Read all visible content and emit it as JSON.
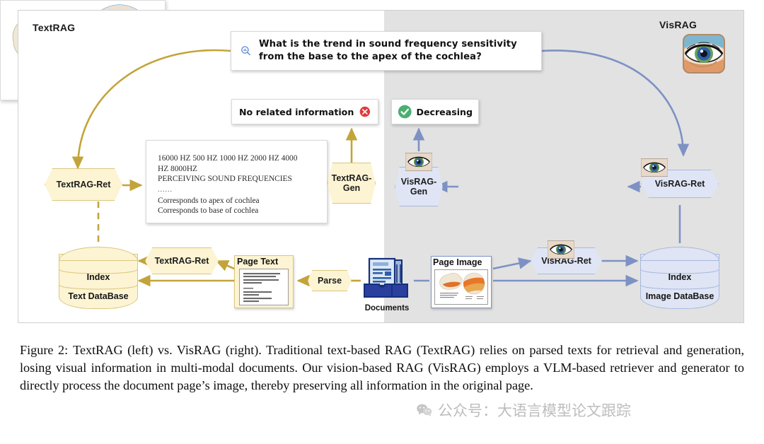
{
  "figure": {
    "left_panel_title": "TextRAG",
    "right_panel_title": "VisRAG",
    "query": {
      "icon": "search-chart-icon",
      "text": "What is the trend in sound frequency sensitivity from the base to the apex of the cochlea?"
    },
    "answers": {
      "text_rag": {
        "label": "No related information",
        "status_icon": "error-cross-icon",
        "status_color": "#e03a3a"
      },
      "vis_rag": {
        "label": "Decreasing",
        "status_icon": "success-check-icon",
        "status_color": "#4caf72"
      }
    },
    "parsed_text": {
      "line1": "16000 HZ 500 HZ 1000 HZ 2000 HZ 4000",
      "line2": "HZ 8000HZ",
      "line3": "PERCEIVING SOUND FREQUENCIES",
      "ellipsis": "......",
      "line4": "Corresponds to apex of cochlea",
      "line5": "Corresponds to base of cochlea"
    },
    "nodes": {
      "textrag_ret_top": "TextRAG-Ret",
      "textrag_ret_bottom": "TextRAG-Ret",
      "textrag_gen": "TextRAG-\nGen",
      "textrag_gen_l1": "TextRAG-",
      "textrag_gen_l2": "Gen",
      "visrag_gen_l1": "VisRAG-",
      "visrag_gen_l2": "Gen",
      "visrag_ret_right": "VisRAG-Ret",
      "visrag_ret_bottom": "VisRAG-Ret",
      "parse": "Parse"
    },
    "databases": {
      "left": {
        "index": "Index",
        "name": "Text DataBase"
      },
      "right": {
        "index": "Index",
        "name": "Image DataBase"
      }
    },
    "artifacts": {
      "page_text": "Page Text",
      "page_image": "Page Image",
      "documents": "Documents"
    },
    "page_document": {
      "heading": "PERCEIVING SOUND FREQUENCIES",
      "body_line1": "In the primary auditory cortex, neurons are sited",
      "body_line2": "according to the frequency each responds to, as",
      "body_line3": "are the sensory cells in the cochlea.",
      "callout_left_l1": "Corresponds",
      "callout_left_l2": "to apex of",
      "callout_left_l3": "cochlea",
      "callout_right_l1": "Corresponds",
      "callout_right_l2": "to base of",
      "callout_right_l3": "cochlea"
    },
    "colors": {
      "text_accent": "#c3a43b",
      "vis_accent": "#7d91c4",
      "panel_left_bg": "#ffffff",
      "panel_right_bg": "#e2e2e2",
      "node_yellow": "#fdf4d3",
      "node_blue": "#dfe5f5"
    }
  },
  "caption": {
    "label": "Figure 2:",
    "text": "TextRAG (left) vs. VisRAG (right). Traditional text-based RAG (TextRAG) relies on parsed texts for retrieval and generation, losing visual information in multi-modal documents. Our vision-based RAG (VisRAG) employs a VLM-based retriever and generator to directly process the document page’s image, thereby preserving all information in the original page."
  },
  "watermark": {
    "icon": "wechat-icon",
    "text": "公众号：大语言模型论文跟踪"
  }
}
